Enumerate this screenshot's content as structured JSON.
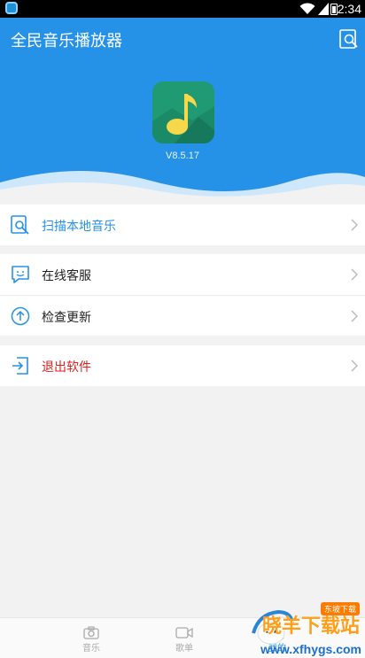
{
  "status_bar": {
    "time": "2:34"
  },
  "app_bar": {
    "title": "全民音乐播放器",
    "scan_icon": "scan-music-icon"
  },
  "header": {
    "version": "V8.5.17",
    "logo_icon": "music-note-icon"
  },
  "menu": {
    "group1": [
      {
        "label": "扫描本地音乐",
        "icon": "scan-icon",
        "color": "#2592e8"
      }
    ],
    "group2": [
      {
        "label": "在线客服",
        "icon": "chat-smile-icon"
      },
      {
        "label": "检查更新",
        "icon": "upload-arrow-icon"
      }
    ],
    "group3": [
      {
        "label": "退出软件",
        "icon": "exit-icon",
        "color": "#e02020"
      }
    ]
  },
  "bottom_nav": {
    "items": [
      {
        "label": "音乐",
        "icon": "camera-icon"
      },
      {
        "label": "歌单",
        "icon": "video-icon"
      },
      {
        "label": "我的",
        "icon": "profile-icon"
      }
    ]
  },
  "watermark": {
    "text": "晓羊下载站",
    "url": "www.xfhygs.com",
    "badge": "东坡下载"
  },
  "colors": {
    "primary": "#2592e8",
    "danger": "#e02020",
    "background": "#f2f2f2"
  }
}
